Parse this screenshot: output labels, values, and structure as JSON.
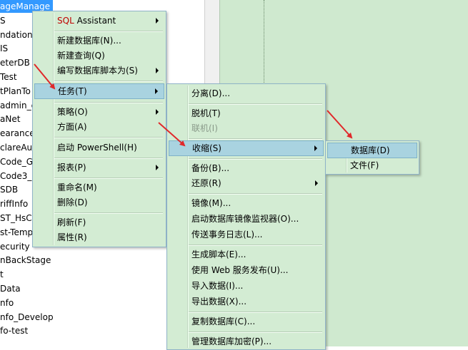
{
  "tree": {
    "nodes": [
      {
        "text": "ageManage",
        "selected": true
      },
      {
        "text": "S"
      },
      {
        "text": "ndation"
      },
      {
        "text": "IS"
      },
      {
        "text": "eterDB"
      },
      {
        "text": "Test"
      },
      {
        "text": "tPlanTo"
      },
      {
        "text": "admin_c"
      },
      {
        "text": "aNet"
      },
      {
        "text": "earance_"
      },
      {
        "text": "clareAu"
      },
      {
        "text": "Code_G"
      },
      {
        "text": "Code3_"
      },
      {
        "text": "SDB"
      },
      {
        "text": "riffInfo"
      },
      {
        "text": "ST_HsCo"
      },
      {
        "text": "st-Temp"
      },
      {
        "text": "ecurity"
      },
      {
        "text": "nBackStage"
      },
      {
        "text": "t"
      },
      {
        "text": "Data"
      },
      {
        "text": "nfo"
      },
      {
        "text": "nfo_Develop"
      },
      {
        "text": "fo-test"
      },
      {
        "text": "..."
      }
    ]
  },
  "menu1": {
    "sql_prefix": "SQL",
    "sql_suffix": " Assistant",
    "new_db": "新建数据库(N)...",
    "new_query": "新建查询(Q)",
    "script_db": "编写数据库脚本为(S)",
    "tasks": "任务(T)",
    "policies": "策略(O)",
    "facets": "方面(A)",
    "powershell": "启动 PowerShell(H)",
    "reports": "报表(P)",
    "rename": "重命名(M)",
    "delete": "删除(D)",
    "refresh": "刷新(F)",
    "properties": "属性(R)"
  },
  "menu2": {
    "detach": "分离(D)...",
    "offline": "脱机(T)",
    "online": "联机(I)",
    "shrink": "收缩(S)",
    "backup": "备份(B)...",
    "restore": "还原(R)",
    "mirror": "镜像(M)...",
    "mirror_monitor": "启动数据库镜像监视器(O)...",
    "log_shipping": "传送事务日志(L)...",
    "gen_scripts": "生成脚本(E)...",
    "web_publish": "使用 Web 服务发布(U)...",
    "import": "导入数据(I)...",
    "export": "导出数据(X)...",
    "copy_db": "复制数据库(C)...",
    "manage_encryption": "管理数据库加密(P)..."
  },
  "menu3": {
    "database": "数据库(D)",
    "files": "文件(F)"
  },
  "colors": {
    "menu_bg": "#d3ecd3",
    "highlight": "#a9d3e0",
    "annotation_arrow": "#e0282a",
    "selection": "#3399ff"
  }
}
